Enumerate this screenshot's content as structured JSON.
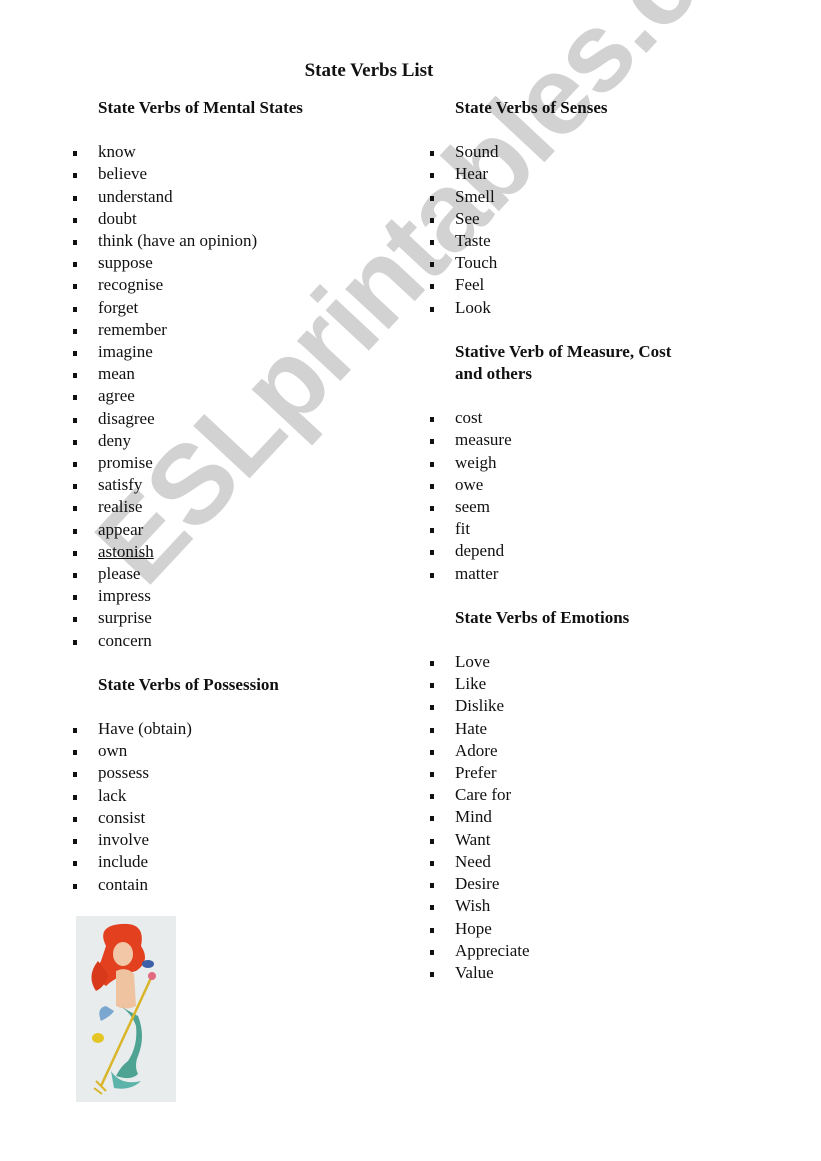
{
  "title": "State Verbs List",
  "watermark": "ESLprintables.com",
  "sections": {
    "mental": {
      "heading": "State Verbs of Mental States",
      "items": [
        "know",
        "believe",
        "understand",
        "doubt",
        "think (have an opinion)",
        "suppose",
        "recognise",
        "forget",
        "remember",
        "imagine",
        "mean",
        "agree",
        "disagree",
        "deny",
        "promise",
        "satisfy",
        "realise",
        "appear",
        "astonish",
        "please",
        "impress",
        "surprise",
        "concern"
      ]
    },
    "possession": {
      "heading": "State Verbs of Possession",
      "items": [
        "Have  (obtain)",
        "own",
        "possess",
        "lack",
        "consist",
        "involve",
        "include",
        "contain"
      ]
    },
    "senses": {
      "heading": "State Verbs of Senses",
      "items": [
        "Sound",
        "Hear",
        "Smell",
        "See",
        "Taste",
        "Touch",
        "Feel",
        "Look"
      ]
    },
    "measure": {
      "heading_line1": "Stative Verb of Measure, Cost",
      "heading_line2": "and others",
      "items": [
        "cost",
        "measure",
        "weigh",
        "owe",
        "seem",
        "fit",
        "depend",
        "matter"
      ]
    },
    "emotions": {
      "heading": "State Verbs of Emotions",
      "items": [
        "Love",
        "Like",
        "Dislike",
        "Hate",
        "Adore",
        "Prefer",
        "Care for",
        "Mind",
        "Want",
        "Need",
        "Desire",
        "Wish",
        "Hope",
        "Appreciate",
        "Value"
      ]
    }
  },
  "image": {
    "alt": "mermaid illustration"
  }
}
